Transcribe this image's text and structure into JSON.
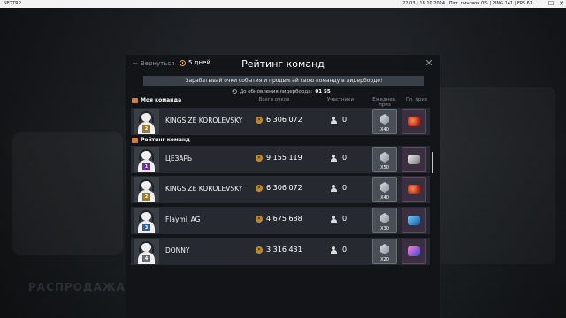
{
  "window": {
    "app_title": "NEXTRP",
    "status_text": "22:03 | 18.10.2024 | Пат. пингвон 0% | PING 141 | FPS 61",
    "controls": [
      "—",
      "☐",
      "✕"
    ]
  },
  "background": {
    "text": "РАСПРОДАЖА!"
  },
  "header": {
    "back_label": "Вернуться",
    "timer_label": "5 дней",
    "title": "Рейтинг команд",
    "close_label": "✕"
  },
  "banner_text": "Зарабатывай очки события и продвигай свою команду в лидерборде!",
  "refresh": {
    "label": "До обновления лидерборда:",
    "value": "01 55"
  },
  "columns": {
    "points": "Всего очков",
    "members": "Участники",
    "daily": "Ежеднев. приз",
    "main": "Гл. приз"
  },
  "my_team": {
    "section_label": "Моя команда",
    "row": {
      "rank": "2",
      "rank_color": "#a07d24",
      "name": "KINGSIZE KOROLEVSKY",
      "points": "6 306 072",
      "members": "0",
      "daily_mult": "X40",
      "prize_icon": "red-gem-icon"
    }
  },
  "rating": {
    "section_label": "Рейтинг команд",
    "rows": [
      {
        "rank": "1",
        "rank_color": "#6a2fa8",
        "name": "ЦЕЗАРЬ",
        "points": "9 155 119",
        "members": "0",
        "daily_mult": "X50",
        "prize_icon": "white-gem-icon"
      },
      {
        "rank": "2",
        "rank_color": "#a07d24",
        "name": "KINGSIZE KOROLEVSKY",
        "points": "6 306 072",
        "members": "0",
        "daily_mult": "X40",
        "prize_icon": "red-gem-icon"
      },
      {
        "rank": "3",
        "rank_color": "#2c5ea0",
        "name": "Flaymi_AG",
        "points": "4 675 688",
        "members": "0",
        "daily_mult": "X30",
        "prize_icon": "blue-gem-icon"
      },
      {
        "rank": "4",
        "rank_color": "#6a6e74",
        "name": "DONNY",
        "points": "3 316 431",
        "members": "0",
        "daily_mult": "X20",
        "prize_icon": "pink-gem-icon"
      }
    ]
  }
}
